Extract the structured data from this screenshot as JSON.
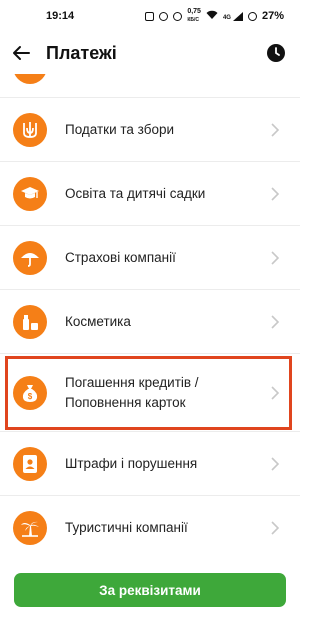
{
  "status_bar": {
    "time": "19:14",
    "network_speed": "0,75",
    "network_unit": "КБ/С",
    "signal": "4G",
    "battery": "27%"
  },
  "header": {
    "title": "Платежі"
  },
  "list": {
    "items": [
      {
        "label": "",
        "icon": "partial-icon"
      },
      {
        "label": "Податки та збори",
        "icon": "trident-icon"
      },
      {
        "label": "Освіта та дитячі садки",
        "icon": "graduation-cap-icon"
      },
      {
        "label": "Страхові компанії",
        "icon": "umbrella-icon"
      },
      {
        "label": "Косметика",
        "icon": "cosmetics-icon"
      },
      {
        "label": "Погашення кредитів /",
        "label2": "Поповнення карток",
        "icon": "money-bag-icon"
      },
      {
        "label": "Штрафи і порушення",
        "icon": "id-badge-icon"
      },
      {
        "label": "Туристичні компанії",
        "icon": "palm-tree-icon"
      }
    ]
  },
  "bottom": {
    "button_label": "За реквізитами"
  },
  "colors": {
    "accent_orange": "#f57f17",
    "button_green": "#3ea83a",
    "highlight_red": "#e0451e"
  }
}
